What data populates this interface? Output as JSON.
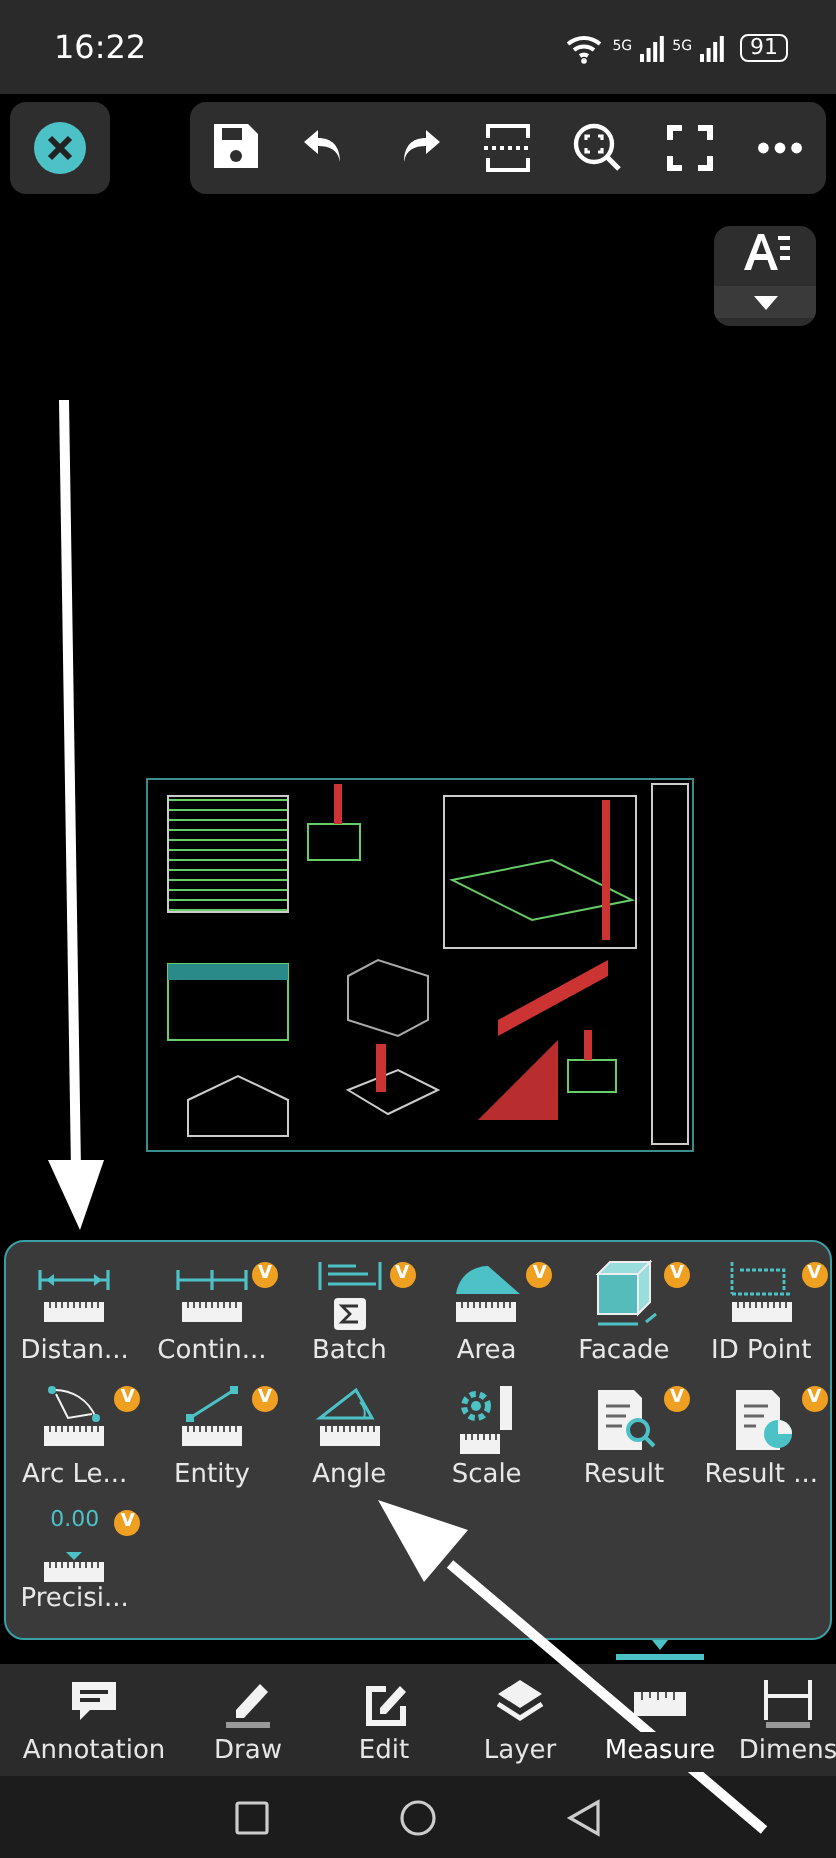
{
  "status_bar": {
    "time": "16:22",
    "networks": [
      "5G",
      "5G"
    ],
    "battery": "91"
  },
  "measure_panel": {
    "tools": [
      {
        "kind": "distance",
        "label": "Distan..."
      },
      {
        "kind": "continuous",
        "label": "Contin...",
        "badge": "V"
      },
      {
        "kind": "batch",
        "label": "Batch",
        "badge": "V"
      },
      {
        "kind": "area",
        "label": "Area",
        "badge": "V"
      },
      {
        "kind": "facade",
        "label": "Facade",
        "badge": "V"
      },
      {
        "kind": "idpoint",
        "label": "ID Point",
        "badge": "V"
      },
      {
        "kind": "arc",
        "label": "Arc Le...",
        "badge": "V"
      },
      {
        "kind": "entity",
        "label": "Entity",
        "badge": "V"
      },
      {
        "kind": "angle",
        "label": "Angle"
      },
      {
        "kind": "scale",
        "label": "Scale"
      },
      {
        "kind": "result",
        "label": "Result",
        "badge": "V"
      },
      {
        "kind": "resultchart",
        "label": "Result ...",
        "badge": "V"
      },
      {
        "kind": "precision",
        "label": "Precisi...",
        "badge": "V",
        "reading": "0.00"
      }
    ]
  },
  "bottom_tabs": [
    {
      "kind": "annotation",
      "label": "Annotation",
      "selected": false
    },
    {
      "kind": "draw",
      "label": "Draw",
      "selected": false
    },
    {
      "kind": "edit",
      "label": "Edit",
      "selected": false
    },
    {
      "kind": "layer",
      "label": "Layer",
      "selected": false
    },
    {
      "kind": "measure",
      "label": "Measure",
      "selected": true
    },
    {
      "kind": "dimension",
      "label": "Dimens",
      "selected": false
    }
  ]
}
